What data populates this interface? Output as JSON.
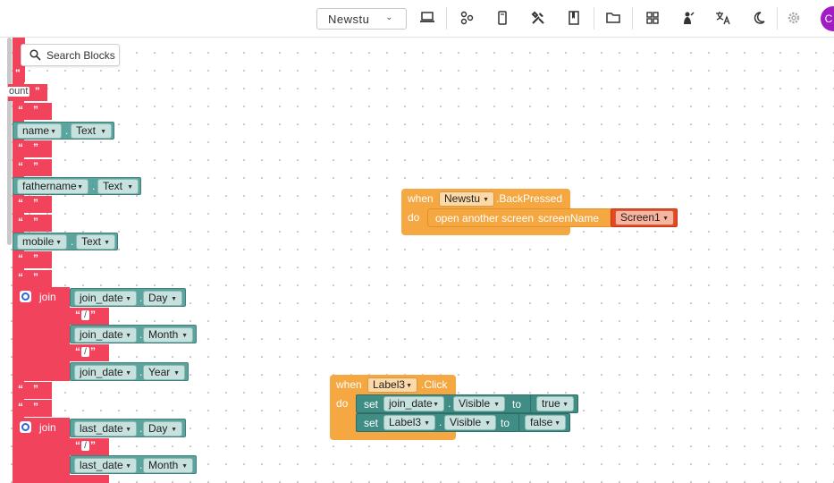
{
  "toolbar": {
    "screen_selector": {
      "value": "Newstu"
    },
    "icons": [
      "laptop-icon",
      "components-icon",
      "phone-icon",
      "tools-icon",
      "book-icon",
      "folder-icon",
      "dashboard-icon",
      "extensions-icon",
      "translate-icon",
      "dark-mode-icon",
      "settings-icon"
    ],
    "avatar_initial": "C"
  },
  "workspace": {
    "search": {
      "label": "Search Blocks"
    },
    "left_column": {
      "str_quote": "\"",
      "str_count_partial": "ount",
      "empty_string": " ",
      "slash_string": "/",
      "fields": [
        {
          "component": "name",
          "property": "Text"
        },
        {
          "component": "fathername",
          "property": "Text"
        },
        {
          "component": "mobile",
          "property": "Text"
        }
      ],
      "join_label": "join",
      "join1": [
        {
          "component": "join_date",
          "property": "Day"
        },
        {
          "component": "join_date",
          "property": "Month"
        },
        {
          "component": "join_date",
          "property": "Year"
        }
      ],
      "join2": [
        {
          "component": "last_date",
          "property": "Day"
        },
        {
          "component": "last_date",
          "property": "Month"
        }
      ]
    },
    "backpressed_event": {
      "when": "when",
      "component": "Newstu",
      "event": ".BackPressed",
      "do": "do",
      "action": "open another screen",
      "param": "screenName",
      "value": "Screen1"
    },
    "click_event": {
      "when": "when",
      "component": "Label3",
      "event": ".Click",
      "do": "do",
      "set_label": "set",
      "to_label": "to",
      "statements": [
        {
          "component": "join_date",
          "property": "Visible",
          "value": "true"
        },
        {
          "component": "Label3",
          "property": "Visible",
          "value": "false"
        }
      ]
    }
  }
}
